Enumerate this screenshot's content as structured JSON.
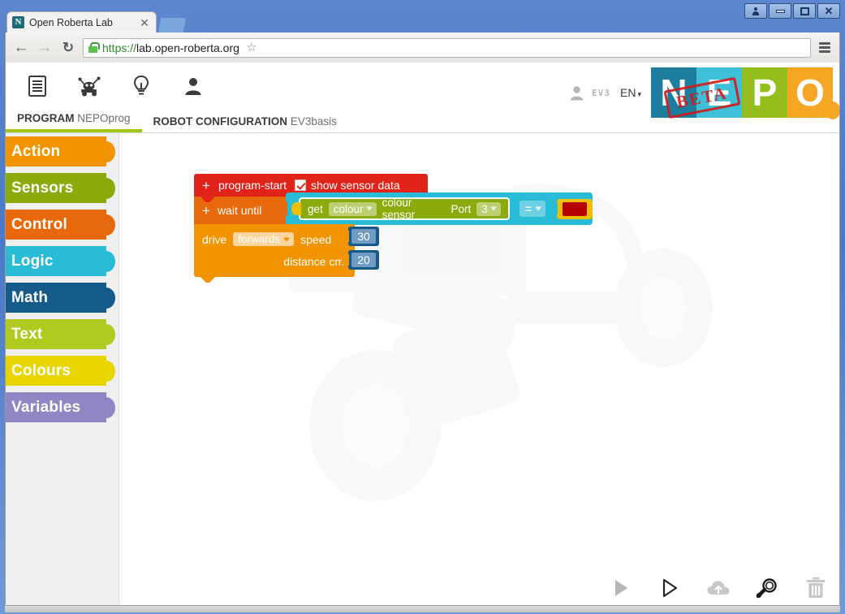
{
  "window": {
    "controls": [
      {
        "name": "user-account-button",
        "glyph": "person"
      },
      {
        "name": "minimize-button",
        "glyph": "min"
      },
      {
        "name": "maximize-button",
        "glyph": "max"
      },
      {
        "name": "close-button",
        "glyph": "x"
      }
    ]
  },
  "browser": {
    "tab": {
      "favicon_letter": "N",
      "title": "Open Roberta Lab",
      "close_label": "✕"
    },
    "new_tab_label": "",
    "nav": {
      "back_label": "←",
      "forward_label": "→",
      "reload_label": "↻"
    },
    "omnibox": {
      "scheme": "https://",
      "host": "lab.open-roberta.org",
      "full_url": "https://lab.open-roberta.org",
      "lock_icon": "secure-lock-icon"
    },
    "star_label": "☆",
    "menu_label": "menu"
  },
  "app": {
    "toolbar_icons": [
      {
        "name": "program-list-icon",
        "title": "program list"
      },
      {
        "name": "robot-icon",
        "title": "robot"
      },
      {
        "name": "lightbulb-icon",
        "title": "tutorial"
      },
      {
        "name": "user-icon",
        "title": "user"
      }
    ],
    "header_right": {
      "user_icon": "user-icon",
      "robot_name": "EV3",
      "language": "EN",
      "language_caret": "▾"
    },
    "logo": {
      "tiles": [
        {
          "letter": "N",
          "color": "#1b7e9e"
        },
        {
          "letter": "E",
          "color": "#3ec0d8"
        },
        {
          "letter": "P",
          "color": "#95bd1c"
        },
        {
          "letter": "O",
          "color": "#f5a623"
        }
      ],
      "beta_stamp": "BETA",
      "beta_color": "#d01c1c"
    },
    "tabs": [
      {
        "name": "tab-program",
        "bold": "PROGRAM",
        "light": "NEPOprog",
        "active": true
      },
      {
        "name": "tab-robot-configuration",
        "bold": "ROBOT CONFIGURATION",
        "light": "EV3basis",
        "active": false
      }
    ],
    "sidebar": {
      "categories": [
        {
          "label": "Action",
          "color": "#f29400"
        },
        {
          "label": "Sensors",
          "color": "#8aab0b"
        },
        {
          "label": "Control",
          "color": "#e8690b"
        },
        {
          "label": "Logic",
          "color": "#29bcd6"
        },
        {
          "label": "Math",
          "color": "#145a8a"
        },
        {
          "label": "Text",
          "color": "#b0cb1f"
        },
        {
          "label": "Colours",
          "color": "#e8d500"
        },
        {
          "label": "Variables",
          "color": "#8f87c4"
        }
      ]
    },
    "program": {
      "start_block": {
        "plus": "+",
        "label": "program-start",
        "checkbox_checked": true,
        "checkbox_label": "show sensor data",
        "color": "#e2231a"
      },
      "wait_block": {
        "plus": "+",
        "label": "wait until",
        "color": "#e8690b"
      },
      "compare_block": {
        "operator": "=",
        "color": "#29bcd6"
      },
      "sensor_block": {
        "get_label": "get",
        "mode_value": "colour",
        "sensor_label": "colour sensor",
        "port_label": "Port",
        "port_value": "3",
        "color": "#8aab0b",
        "selected": true
      },
      "colour_block": {
        "swatch_color": "#b50000",
        "block_color": "#f0c000"
      },
      "drive_block": {
        "drive_label": "drive",
        "direction_value": "forwards",
        "speed_label": "speed",
        "speed_value": "30",
        "distance_label": "distance cm",
        "distance_value": "20",
        "color": "#f29400"
      }
    },
    "bottom_toolbar": [
      {
        "name": "run-program-button",
        "icon": "play-filled-icon",
        "state": "disabled"
      },
      {
        "name": "start-sim-button",
        "icon": "play-outline-icon",
        "state": "enabled"
      },
      {
        "name": "upload-button",
        "icon": "cloud-upload-icon",
        "state": "disabled"
      },
      {
        "name": "check-program-button",
        "icon": "magnifier-icon",
        "state": "enabled"
      },
      {
        "name": "delete-button",
        "icon": "trash-icon",
        "state": "disabled"
      }
    ],
    "workspace": {
      "watermark": "ev3-robot-watermark"
    }
  }
}
